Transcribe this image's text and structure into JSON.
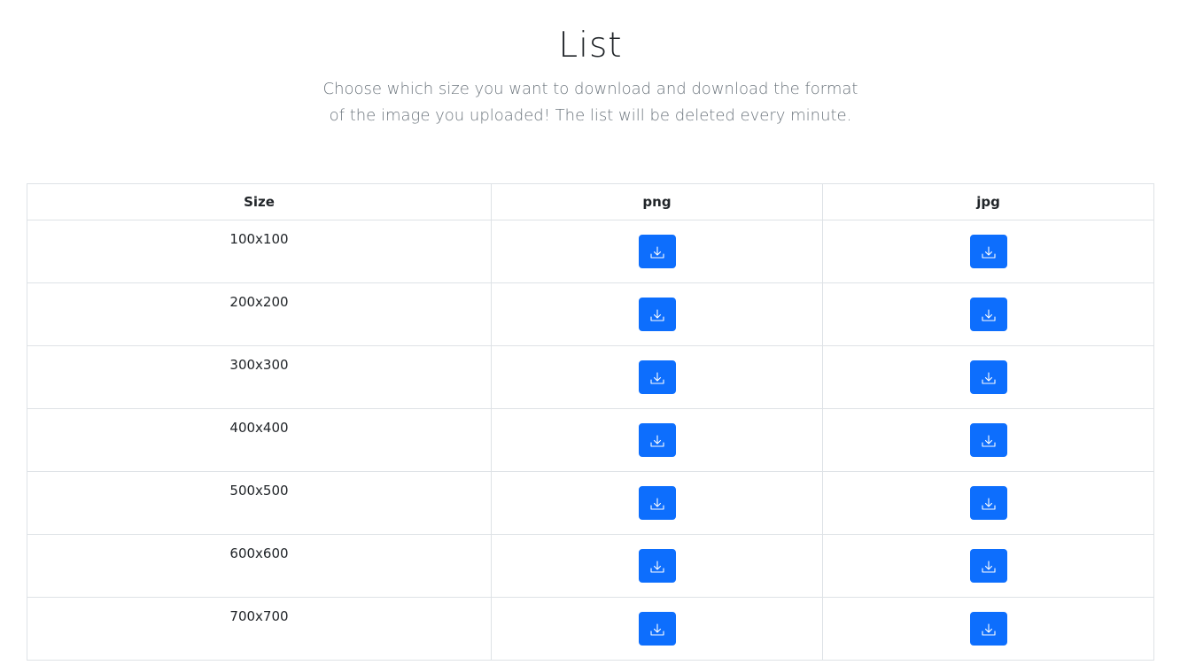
{
  "header": {
    "title": "List",
    "subtitle": "Choose which size you want to download and download the format of the image you uploaded! The list will be deleted every minute."
  },
  "table": {
    "columns": [
      "Size",
      "png",
      "jpg"
    ],
    "rows": [
      {
        "size": "100x100"
      },
      {
        "size": "200x200"
      },
      {
        "size": "300x300"
      },
      {
        "size": "400x400"
      },
      {
        "size": "500x500"
      },
      {
        "size": "600x600"
      },
      {
        "size": "700x700"
      }
    ],
    "button_icon": "download-icon"
  },
  "colors": {
    "accent": "#0d6efd",
    "border": "#dee2e6",
    "muted_text": "#6c757d",
    "text": "#212529"
  }
}
